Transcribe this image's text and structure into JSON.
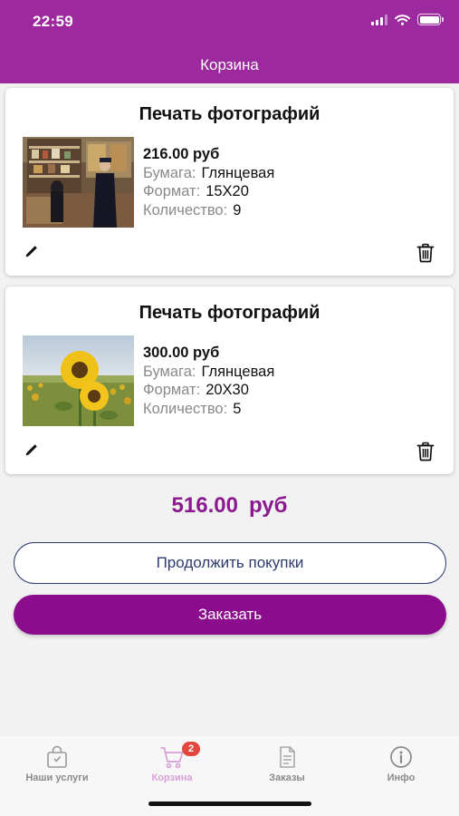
{
  "status_bar": {
    "time": "22:59"
  },
  "header": {
    "title": "Корзина",
    "background": "#9c2a9e"
  },
  "cart_items": [
    {
      "title": "Печать фотографий",
      "image": "shop-interior-photo",
      "price": "216.00 руб",
      "paper_label": "Бумага:",
      "paper_value": "Глянцевая",
      "format_label": "Формат:",
      "format_value": "15X20",
      "quantity_label": "Количество:",
      "quantity_value": "9"
    },
    {
      "title": "Печать фотографий",
      "image": "sunflowers-photo",
      "price": "300.00 руб",
      "paper_label": "Бумага:",
      "paper_value": "Глянцевая",
      "format_label": "Формат:",
      "format_value": "20X30",
      "quantity_label": "Количество:",
      "quantity_value": "5"
    }
  ],
  "total": {
    "amount": "516.00",
    "currency": "руб",
    "color": "#8a1a8e"
  },
  "buttons": {
    "continue_label": "Продолжить покупки",
    "order_label": "Заказать",
    "order_color": "#8b0d8d"
  },
  "tabbar": {
    "tabs": [
      {
        "label": "Наши услуги",
        "icon": "bag-icon",
        "active": false
      },
      {
        "label": "Корзина",
        "icon": "cart-icon",
        "active": true,
        "badge": "2"
      },
      {
        "label": "Заказы",
        "icon": "document-icon",
        "active": false
      },
      {
        "label": "Инфо",
        "icon": "info-icon",
        "active": false
      }
    ]
  }
}
